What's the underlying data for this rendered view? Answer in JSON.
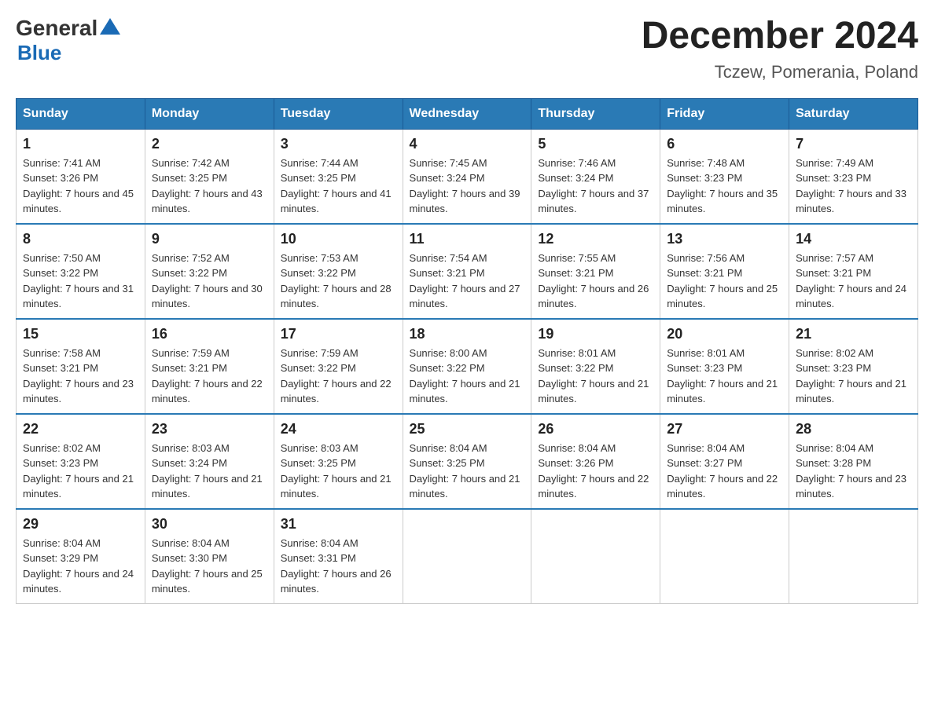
{
  "logo": {
    "text1": "General",
    "triangle": "▲",
    "text2": "Blue"
  },
  "title": "December 2024",
  "subtitle": "Tczew, Pomerania, Poland",
  "weekdays": [
    "Sunday",
    "Monday",
    "Tuesday",
    "Wednesday",
    "Thursday",
    "Friday",
    "Saturday"
  ],
  "weeks": [
    [
      {
        "day": "1",
        "sunrise": "7:41 AM",
        "sunset": "3:26 PM",
        "daylight": "7 hours and 45 minutes."
      },
      {
        "day": "2",
        "sunrise": "7:42 AM",
        "sunset": "3:25 PM",
        "daylight": "7 hours and 43 minutes."
      },
      {
        "day": "3",
        "sunrise": "7:44 AM",
        "sunset": "3:25 PM",
        "daylight": "7 hours and 41 minutes."
      },
      {
        "day": "4",
        "sunrise": "7:45 AM",
        "sunset": "3:24 PM",
        "daylight": "7 hours and 39 minutes."
      },
      {
        "day": "5",
        "sunrise": "7:46 AM",
        "sunset": "3:24 PM",
        "daylight": "7 hours and 37 minutes."
      },
      {
        "day": "6",
        "sunrise": "7:48 AM",
        "sunset": "3:23 PM",
        "daylight": "7 hours and 35 minutes."
      },
      {
        "day": "7",
        "sunrise": "7:49 AM",
        "sunset": "3:23 PM",
        "daylight": "7 hours and 33 minutes."
      }
    ],
    [
      {
        "day": "8",
        "sunrise": "7:50 AM",
        "sunset": "3:22 PM",
        "daylight": "7 hours and 31 minutes."
      },
      {
        "day": "9",
        "sunrise": "7:52 AM",
        "sunset": "3:22 PM",
        "daylight": "7 hours and 30 minutes."
      },
      {
        "day": "10",
        "sunrise": "7:53 AM",
        "sunset": "3:22 PM",
        "daylight": "7 hours and 28 minutes."
      },
      {
        "day": "11",
        "sunrise": "7:54 AM",
        "sunset": "3:21 PM",
        "daylight": "7 hours and 27 minutes."
      },
      {
        "day": "12",
        "sunrise": "7:55 AM",
        "sunset": "3:21 PM",
        "daylight": "7 hours and 26 minutes."
      },
      {
        "day": "13",
        "sunrise": "7:56 AM",
        "sunset": "3:21 PM",
        "daylight": "7 hours and 25 minutes."
      },
      {
        "day": "14",
        "sunrise": "7:57 AM",
        "sunset": "3:21 PM",
        "daylight": "7 hours and 24 minutes."
      }
    ],
    [
      {
        "day": "15",
        "sunrise": "7:58 AM",
        "sunset": "3:21 PM",
        "daylight": "7 hours and 23 minutes."
      },
      {
        "day": "16",
        "sunrise": "7:59 AM",
        "sunset": "3:21 PM",
        "daylight": "7 hours and 22 minutes."
      },
      {
        "day": "17",
        "sunrise": "7:59 AM",
        "sunset": "3:22 PM",
        "daylight": "7 hours and 22 minutes."
      },
      {
        "day": "18",
        "sunrise": "8:00 AM",
        "sunset": "3:22 PM",
        "daylight": "7 hours and 21 minutes."
      },
      {
        "day": "19",
        "sunrise": "8:01 AM",
        "sunset": "3:22 PM",
        "daylight": "7 hours and 21 minutes."
      },
      {
        "day": "20",
        "sunrise": "8:01 AM",
        "sunset": "3:23 PM",
        "daylight": "7 hours and 21 minutes."
      },
      {
        "day": "21",
        "sunrise": "8:02 AM",
        "sunset": "3:23 PM",
        "daylight": "7 hours and 21 minutes."
      }
    ],
    [
      {
        "day": "22",
        "sunrise": "8:02 AM",
        "sunset": "3:23 PM",
        "daylight": "7 hours and 21 minutes."
      },
      {
        "day": "23",
        "sunrise": "8:03 AM",
        "sunset": "3:24 PM",
        "daylight": "7 hours and 21 minutes."
      },
      {
        "day": "24",
        "sunrise": "8:03 AM",
        "sunset": "3:25 PM",
        "daylight": "7 hours and 21 minutes."
      },
      {
        "day": "25",
        "sunrise": "8:04 AM",
        "sunset": "3:25 PM",
        "daylight": "7 hours and 21 minutes."
      },
      {
        "day": "26",
        "sunrise": "8:04 AM",
        "sunset": "3:26 PM",
        "daylight": "7 hours and 22 minutes."
      },
      {
        "day": "27",
        "sunrise": "8:04 AM",
        "sunset": "3:27 PM",
        "daylight": "7 hours and 22 minutes."
      },
      {
        "day": "28",
        "sunrise": "8:04 AM",
        "sunset": "3:28 PM",
        "daylight": "7 hours and 23 minutes."
      }
    ],
    [
      {
        "day": "29",
        "sunrise": "8:04 AM",
        "sunset": "3:29 PM",
        "daylight": "7 hours and 24 minutes."
      },
      {
        "day": "30",
        "sunrise": "8:04 AM",
        "sunset": "3:30 PM",
        "daylight": "7 hours and 25 minutes."
      },
      {
        "day": "31",
        "sunrise": "8:04 AM",
        "sunset": "3:31 PM",
        "daylight": "7 hours and 26 minutes."
      },
      null,
      null,
      null,
      null
    ]
  ]
}
